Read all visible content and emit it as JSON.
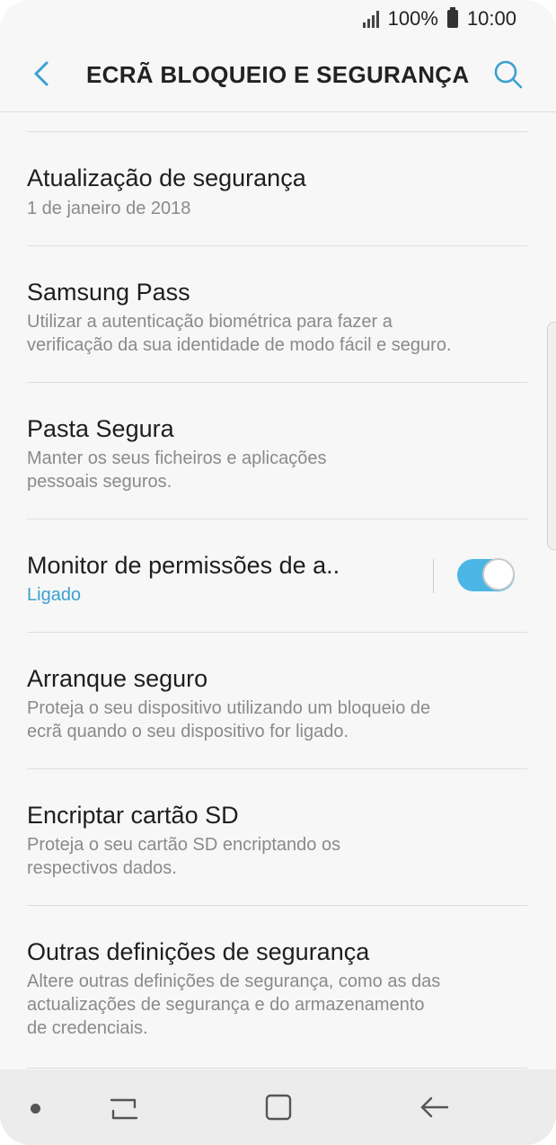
{
  "status_bar": {
    "battery": "100%",
    "time": "10:00"
  },
  "header": {
    "title": "ECRÃ BLOQUEIO E SEGURANÇA",
    "back_icon": "back-arrow-icon",
    "search_icon": "search-icon"
  },
  "items": [
    {
      "title": "Atualização de segurança",
      "subtitle": "1 de janeiro de 2018"
    },
    {
      "title": "Samsung Pass",
      "subtitle_lines": [
        "Utilizar a autenticação biométrica para fazer a",
        "verificação da sua identidade de modo fácil e seguro."
      ]
    },
    {
      "title": "Pasta Segura",
      "subtitle_lines": [
        "Manter os seus ficheiros e aplicações",
        "pessoais seguros."
      ]
    },
    {
      "title": "Monitor de permissões de a..",
      "subtitle": "Ligado",
      "toggle_on": true
    },
    {
      "title": "Arranque seguro",
      "subtitle_lines": [
        "Proteja o seu dispositivo utilizando um bloqueio de",
        "ecrã quando o seu dispositivo for ligado."
      ]
    },
    {
      "title": "Encriptar cartão SD",
      "subtitle_lines": [
        "Proteja o seu cartão SD encriptando os",
        "respectivos dados."
      ]
    },
    {
      "title": "Outras definições de segurança",
      "subtitle_lines": [
        "Altere outras definições de segurança, como as das",
        "actualizações de segurança e do armazenamento",
        "de credenciais."
      ]
    }
  ],
  "colors": {
    "accent": "#3aa0d0",
    "toggle": "#4bb6e6",
    "background": "#f7f7f7"
  }
}
